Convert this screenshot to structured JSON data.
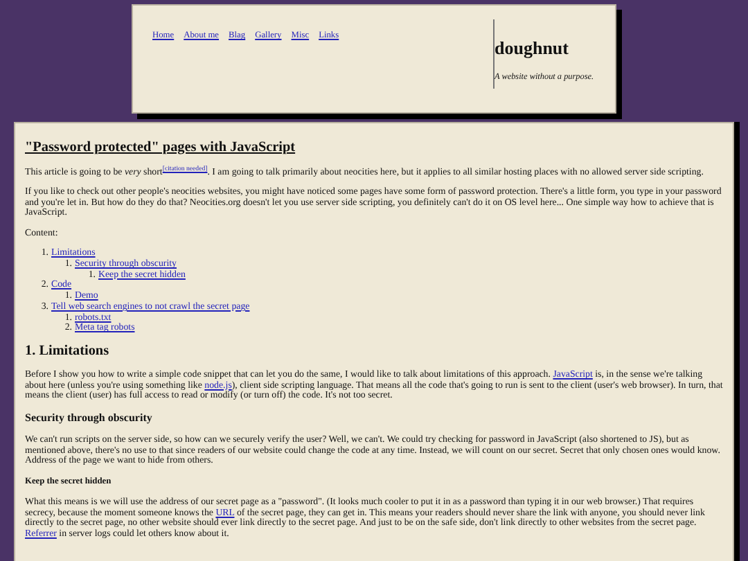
{
  "header": {
    "nav": [
      "Home",
      "About me",
      "Blag",
      "Gallery",
      "Misc",
      "Links"
    ],
    "site_title": "doughnut",
    "tagline": "A website without a purpose."
  },
  "article": {
    "title": "\"Password protected\" pages with JavaScript",
    "blocks": [
      {
        "kind": "paragraph",
        "parts": [
          {
            "kind": "text",
            "text": "This article is going to be *very* short"
          },
          {
            "kind": "citation",
            "text": "[citation needed]"
          },
          {
            "kind": "text",
            "text": ". I am going to talk primarily about neocities here, but it applies to all similar hosting places with no allowed server side scripting."
          }
        ]
      },
      {
        "kind": "paragraph",
        "parts": [
          {
            "kind": "text",
            "text": "If you like to check out other people's neocities websites, you might have noticed some pages have some form of password protection. There's a little form, you type in your password and you're let in. But how do they do that? Neocities.org doesn't let you use server side scripting, you definitely can't do it on OS level here... One simple way how to achieve that is JavaScript."
          }
        ]
      },
      {
        "kind": "paragraph",
        "parts": [
          {
            "kind": "text",
            "text": "Content:"
          }
        ]
      },
      {
        "kind": "toc",
        "items": [
          {
            "number": "1.",
            "label": "Limitations",
            "children": [
              {
                "number": "1.",
                "label": "Security through obscurity",
                "children": [
                  {
                    "number": "1.",
                    "label": "Keep the secret hidden"
                  }
                ]
              }
            ]
          },
          {
            "number": "2.",
            "label": "Code",
            "children": [
              {
                "number": "1.",
                "label": "Demo"
              }
            ]
          },
          {
            "number": "3.",
            "label": "Tell web search engines to not crawl the secret page",
            "children": [
              {
                "number": "1.",
                "label": "robots.txt"
              },
              {
                "number": "2.",
                "label": "Meta tag robots"
              }
            ]
          }
        ]
      },
      {
        "kind": "h2",
        "text": "1. Limitations"
      },
      {
        "kind": "paragraph",
        "parts": [
          {
            "kind": "text",
            "text": "Before I show you how to write a simple code snippet that can let you do the same, I would like to talk about limitations of this approach. "
          },
          {
            "kind": "link",
            "text": "JavaScript"
          },
          {
            "kind": "text",
            "text": " is, in the sense we're talking about here (unless you're using something like "
          },
          {
            "kind": "link",
            "text": "node.js"
          },
          {
            "kind": "text",
            "text": "), client side scripting language. That means all the code that's going to run is sent to the client (user's web browser). In turn, that means the client (user) has full access to read or modify (or turn off) the code. It's not too secret."
          }
        ]
      },
      {
        "kind": "h3",
        "text": "Security through obscurity"
      },
      {
        "kind": "paragraph",
        "parts": [
          {
            "kind": "text",
            "text": "We can't run scripts on the server side, so how can we securely verify the user? Well, we can't. We could try checking for password in JavaScript (also shortened to JS), but as mentioned above, there's no use to that since readers of our website could change the code at any time. Instead, we will count on our secret. Secret that only chosen ones would know. Address of the page we want to hide from others."
          }
        ]
      },
      {
        "kind": "h4",
        "text": "Keep the secret hidden"
      },
      {
        "kind": "paragraph",
        "parts": [
          {
            "kind": "text",
            "text": "What this means is we will use the address of our secret page as a \"password\". (It looks much cooler to put it in as a password than typing it in our web browser.) That requires secrecy, because the moment someone knows the "
          },
          {
            "kind": "link",
            "text": "URL"
          },
          {
            "kind": "text",
            "text": " of the secret page, they can get in. This means your readers should never share the link with anyone, you should never link directly to the secret page, no other website should ever link directly to the secret page. And just to be on the safe side, don't link directly to other websites from the secret page. "
          },
          {
            "kind": "link",
            "text": "Referrer"
          },
          {
            "kind": "text",
            "text": " in server logs could let others know about it."
          }
        ]
      }
    ]
  }
}
